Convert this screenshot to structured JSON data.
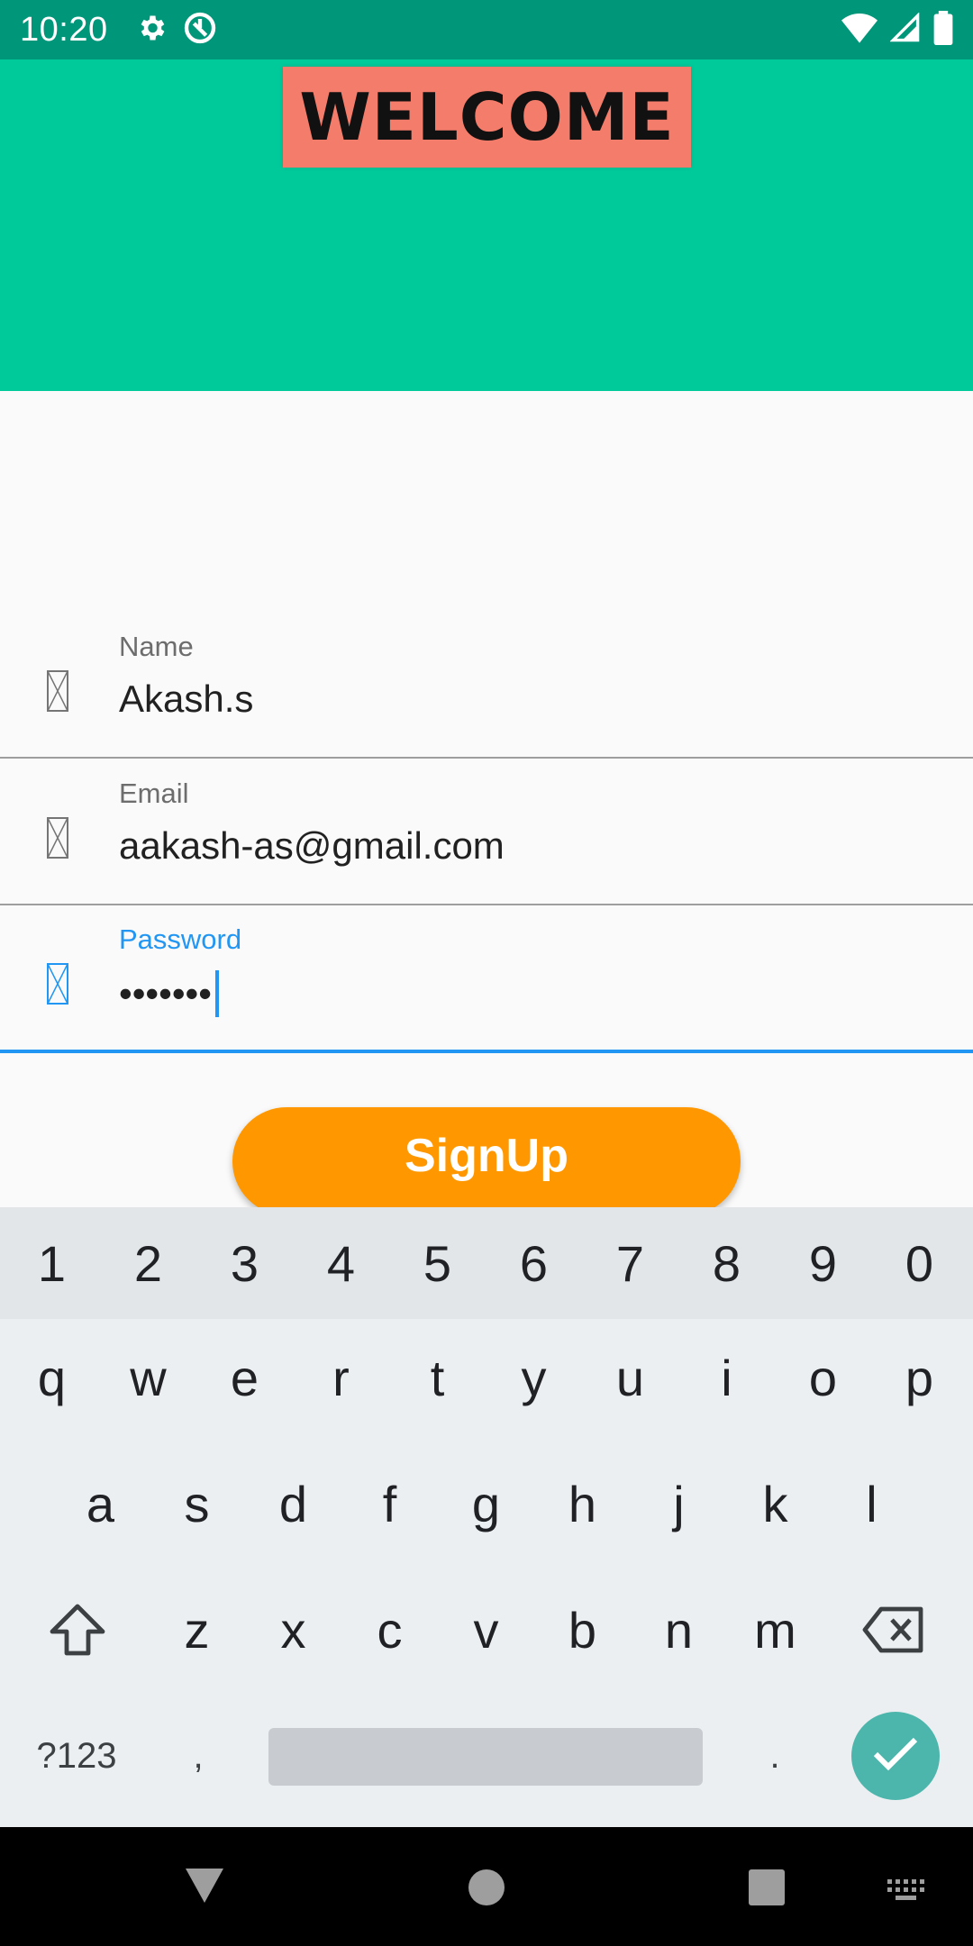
{
  "status_bar": {
    "time": "10:20",
    "left_icons": [
      "gear-icon",
      "sync-disabled-icon"
    ],
    "right_icons": [
      "wifi-icon",
      "signal-icon",
      "battery-icon"
    ]
  },
  "header": {
    "banner_text": "WELCOME",
    "background_color": "#00c99a",
    "banner_color": "#f47c6a"
  },
  "form": {
    "name": {
      "label": "Name",
      "value": "Akash.s",
      "icon": "broken-image-icon"
    },
    "email": {
      "label": "Email",
      "value": "aakash-as@gmail.com",
      "icon": "broken-image-icon"
    },
    "password": {
      "label": "Password",
      "value": "•••••••",
      "icon": "broken-image-icon",
      "focused": true
    },
    "signup_label": "SignUp",
    "accent_color": "#2196f3",
    "button_color": "#ff9800"
  },
  "keyboard": {
    "number_row": [
      "1",
      "2",
      "3",
      "4",
      "5",
      "6",
      "7",
      "8",
      "9",
      "0"
    ],
    "row1": [
      "q",
      "w",
      "e",
      "r",
      "t",
      "y",
      "u",
      "i",
      "o",
      "p"
    ],
    "row2": [
      "a",
      "s",
      "d",
      "f",
      "g",
      "h",
      "j",
      "k",
      "l"
    ],
    "row3": [
      "z",
      "x",
      "c",
      "v",
      "b",
      "n",
      "m"
    ],
    "symbols_key": "?123",
    "comma_key": ",",
    "period_key": ".",
    "shift_icon": "shift-icon",
    "backspace_icon": "backspace-icon",
    "enter_icon": "check-icon"
  },
  "nav_bar": {
    "icons": [
      "back-icon",
      "home-icon",
      "recents-icon",
      "keyboard-switch-icon"
    ]
  }
}
